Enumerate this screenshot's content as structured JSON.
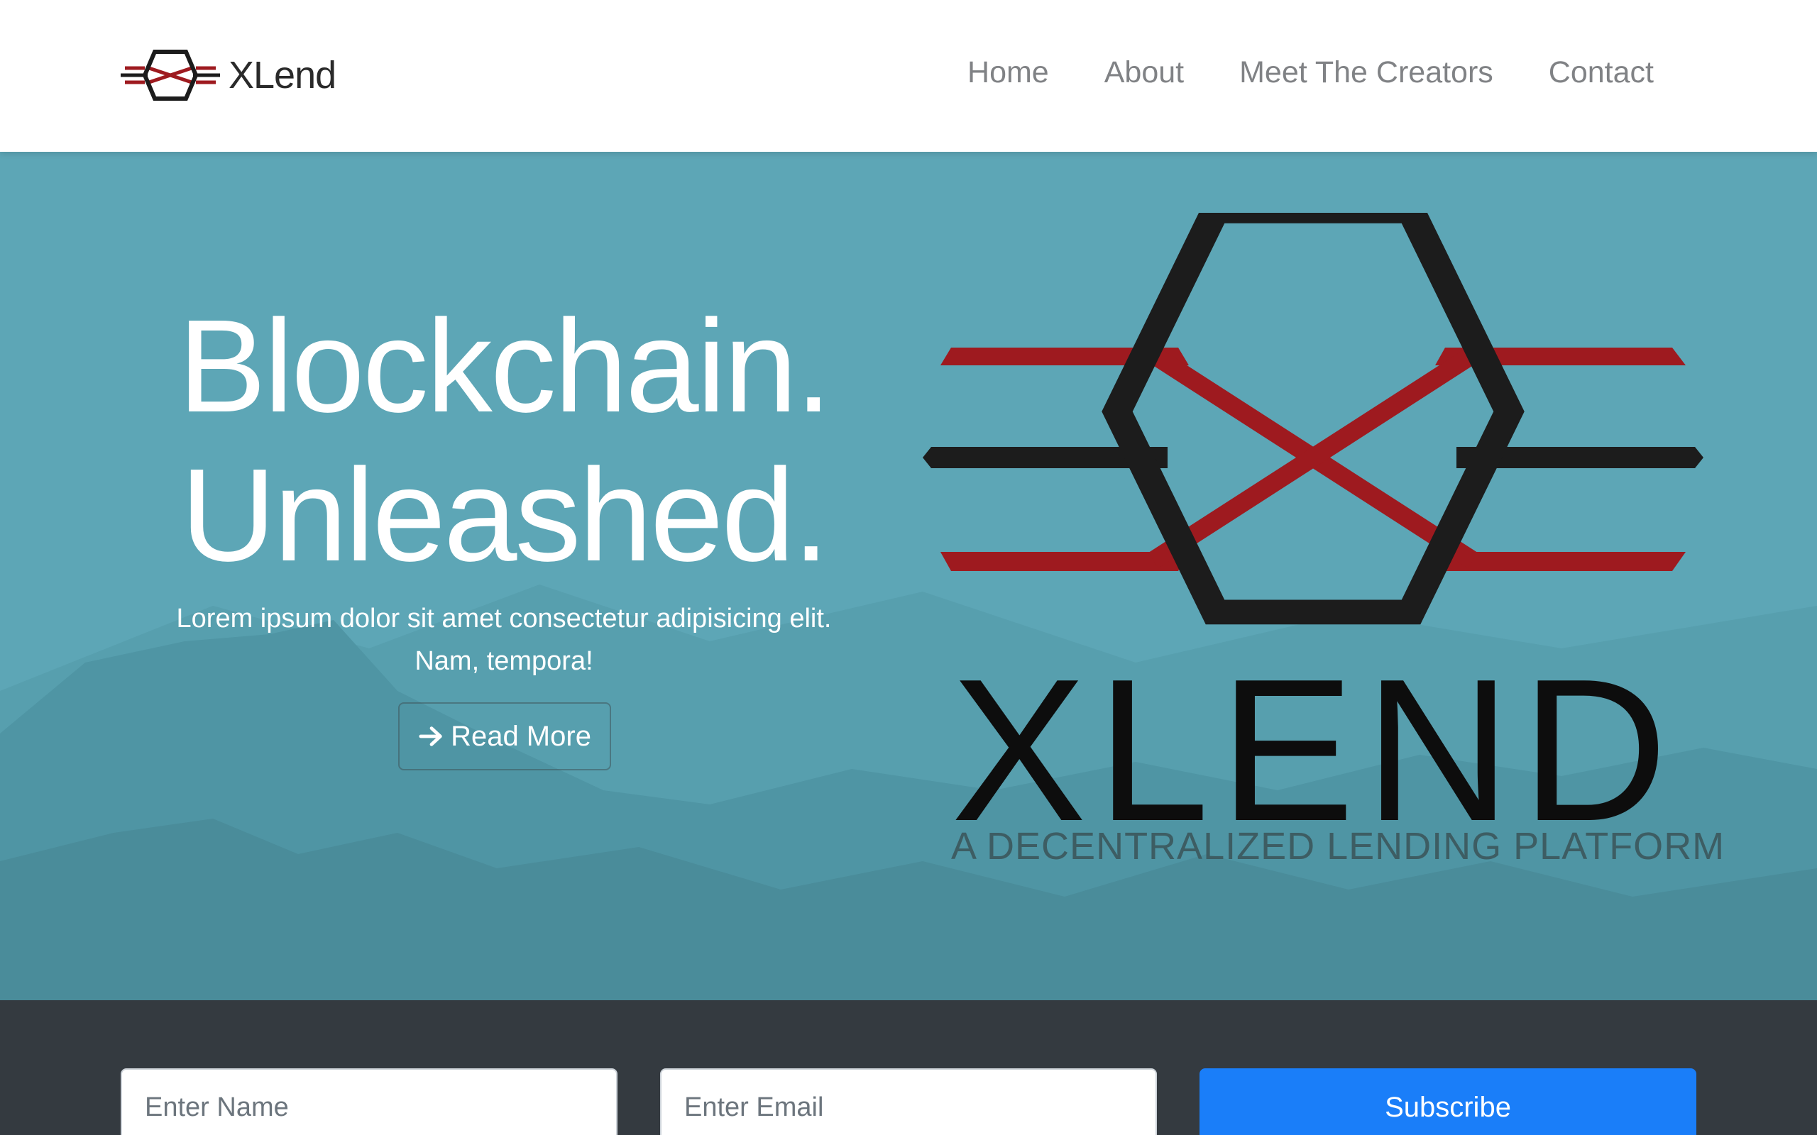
{
  "brand": {
    "name": "XLend",
    "logo_icon": "xlend-hexagon-logo-icon"
  },
  "nav": {
    "items": [
      {
        "label": "Home"
      },
      {
        "label": "About"
      },
      {
        "label": "Meet The Creators"
      },
      {
        "label": "Contact"
      }
    ]
  },
  "hero": {
    "headline_line1": "Blockchain.",
    "headline_line2": "Unleashed.",
    "lead": "Lorem ipsum dolor sit amet consectetur adipisicing elit. Nam, tempora!",
    "read_more_label": "Read More",
    "read_more_icon": "arrow-right-icon",
    "logo_word": "XLEND",
    "tagline": "A DECENTRALIZED LENDING PLATFORM"
  },
  "subscribe": {
    "name_placeholder": "Enter Name",
    "email_placeholder": "Enter Email",
    "button_label": "Subscribe"
  },
  "colors": {
    "hero_bg": "#5da6b6",
    "logo_red": "#9e1a1f",
    "logo_dark": "#1c1c1c",
    "footer_bg": "#343a40",
    "primary": "#1a7ef9"
  }
}
